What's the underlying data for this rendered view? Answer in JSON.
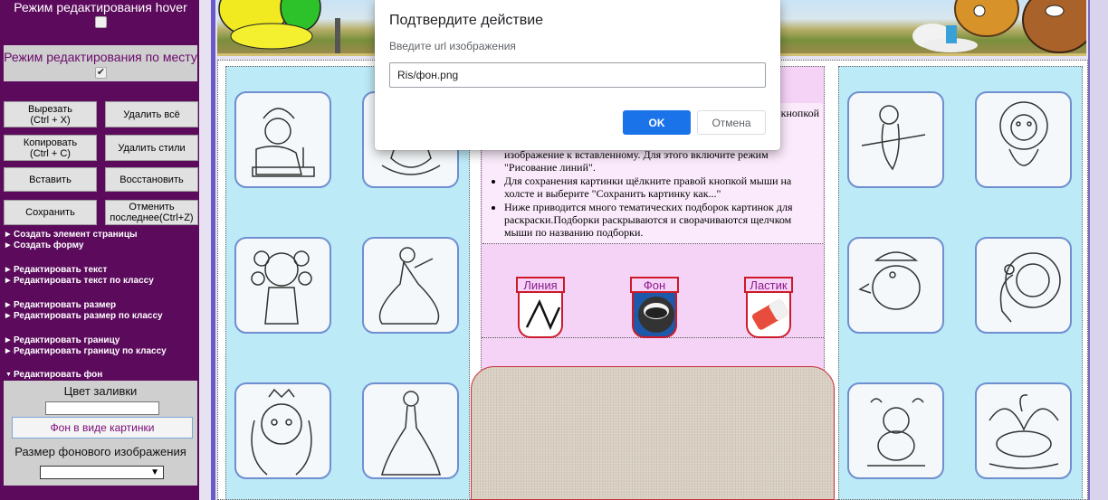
{
  "sidebar": {
    "hover_mode_label": "Режим редактирования hover",
    "inplace_mode_label": "Режим редактирования по месту",
    "inplace_checked_mark": "✔",
    "buttons": {
      "cut": "Вырезать\n(Ctrl + X)",
      "delete_all": "Удалить всё",
      "copy": "Копировать\n(Ctrl + C)",
      "delete_styles": "Удалить стили",
      "paste": "Вставить",
      "restore": "Восстановить",
      "save": "Сохранить",
      "undo": "Отменить\nпоследнее(Ctrl+Z)"
    },
    "menu": [
      "Создать элемент страницы",
      "Создать форму",
      "Редактировать текст",
      "Редактировать текст по классу",
      "Редактировать размер",
      "Редактировать размер по классу",
      "Редактировать границу",
      "Редактировать границу по классу",
      "Редактировать фон"
    ],
    "fill_color_label": "Цвет заливки",
    "bg_image_button": "Фон в виде картинки",
    "bg_size_label": "Размер фонового изображения",
    "bg_size_value": ""
  },
  "center": {
    "corner_text": "кнопкой",
    "bullets": [
      "изображение к вставленному. Для этого включите режим \"Рисование линий\".",
      "Для сохранения картинки щёлкните правой кнопкой мыши на холсте и выберите \"Сохранить картинку как...\"",
      "Ниже приводится много тематических подборок картинок для раскраски.Подборки раскрываются и сворачиваются щелчком мыши по названию подборки."
    ],
    "tools": [
      "Линия",
      "Фон",
      "Ластик"
    ]
  },
  "dialog": {
    "title": "Подтвердите действие",
    "subtitle": "Введите url изображения",
    "input_value": "Ris/фон.png",
    "ok": "OK",
    "cancel": "Отмена"
  },
  "colors": {
    "sidebar_bg": "#5b0a5c",
    "gallery_bg": "#bdeaf7",
    "center_bg": "#f5d3f6",
    "dialog_ok": "#1a73e8",
    "tool_border": "#cc1a2a"
  }
}
